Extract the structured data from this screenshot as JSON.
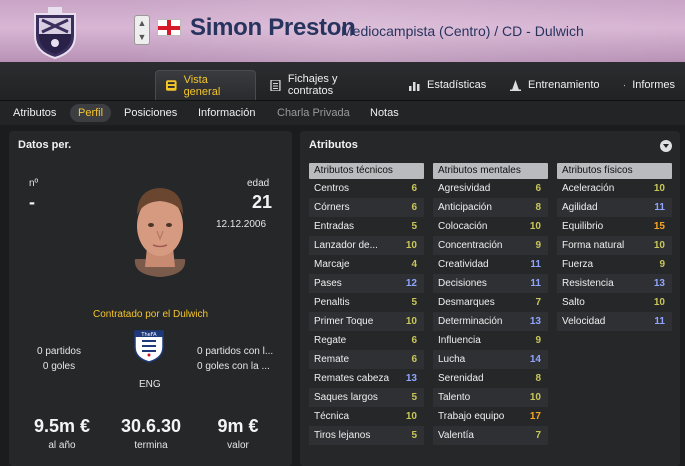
{
  "header": {
    "player_name": "Simon Preston",
    "player_role": "Mediocampista (Centro) / CD - Dulwich",
    "nationality_flag": "england-flag",
    "colors": {
      "name": "#27345e",
      "background": "#d3b1cf"
    }
  },
  "main_tabs": [
    {
      "label": "Vista general",
      "icon": "overview-icon",
      "active": true
    },
    {
      "label": "Fichajes y contratos",
      "icon": "document-icon"
    },
    {
      "label": "Estadísticas",
      "icon": "stats-icon"
    },
    {
      "label": "Entrenamiento",
      "icon": "training-cone-icon"
    },
    {
      "label": "Informes",
      "icon": "report-icon"
    }
  ],
  "sub_tabs": [
    {
      "label": "Atributos"
    },
    {
      "label": "Perfil",
      "active": true
    },
    {
      "label": "Posiciones"
    },
    {
      "label": "Información"
    },
    {
      "label": "Charla Privada",
      "muted": true
    },
    {
      "label": "Notas"
    }
  ],
  "personal": {
    "title": "Datos per.",
    "number_label": "nº",
    "number_value": "-",
    "age_label": "edad",
    "age_value": "21",
    "birth_date": "12.12.2006",
    "contract": "Contratado por el Dulwich",
    "fa_text": "TheFA",
    "nation_code": "ENG",
    "club_matches": "0 partidos",
    "club_goals": "0 goles",
    "intl_matches": "0 partidos con l...",
    "intl_goals": "0 goles con la ...",
    "wage_value": "9.5m €",
    "wage_label": "al año",
    "expiry_value": "30.6.30",
    "expiry_label": "termina",
    "value_value": "9m €",
    "value_label": "valor"
  },
  "attributes": {
    "title": "Atributos",
    "columns": [
      {
        "header": "Atributos técnicos",
        "rows": [
          {
            "name": "Centros",
            "value": "6"
          },
          {
            "name": "Córners",
            "value": "6"
          },
          {
            "name": "Entradas",
            "value": "5"
          },
          {
            "name": "Lanzador de...",
            "value": "10"
          },
          {
            "name": "Marcaje",
            "value": "4"
          },
          {
            "name": "Pases",
            "value": "12"
          },
          {
            "name": "Penaltis",
            "value": "5"
          },
          {
            "name": "Primer Toque",
            "value": "10"
          },
          {
            "name": "Regate",
            "value": "6"
          },
          {
            "name": "Remate",
            "value": "6"
          },
          {
            "name": "Remates cabeza",
            "value": "13"
          },
          {
            "name": "Saques largos",
            "value": "5"
          },
          {
            "name": "Técnica",
            "value": "10"
          },
          {
            "name": "Tiros lejanos",
            "value": "5"
          }
        ]
      },
      {
        "header": "Atributos mentales",
        "rows": [
          {
            "name": "Agresividad",
            "value": "6"
          },
          {
            "name": "Anticipación",
            "value": "8"
          },
          {
            "name": "Colocación",
            "value": "10"
          },
          {
            "name": "Concentración",
            "value": "9"
          },
          {
            "name": "Creatividad",
            "value": "11"
          },
          {
            "name": "Decisiones",
            "value": "11"
          },
          {
            "name": "Desmarques",
            "value": "7"
          },
          {
            "name": "Determinación",
            "value": "13"
          },
          {
            "name": "Influencia",
            "value": "9"
          },
          {
            "name": "Lucha",
            "value": "14"
          },
          {
            "name": "Serenidad",
            "value": "8"
          },
          {
            "name": "Talento",
            "value": "10"
          },
          {
            "name": "Trabajo equipo",
            "value": "17"
          },
          {
            "name": "Valentía",
            "value": "7"
          }
        ]
      },
      {
        "header": "Atributos físicos",
        "rows": [
          {
            "name": "Aceleración",
            "value": "10"
          },
          {
            "name": "Agilidad",
            "value": "11"
          },
          {
            "name": "Equilibrio",
            "value": "15"
          },
          {
            "name": "Forma natural",
            "value": "10"
          },
          {
            "name": "Fuerza",
            "value": "9"
          },
          {
            "name": "Resistencia",
            "value": "13"
          },
          {
            "name": "Salto",
            "value": "10"
          },
          {
            "name": "Velocidad",
            "value": "11"
          }
        ]
      }
    ]
  }
}
